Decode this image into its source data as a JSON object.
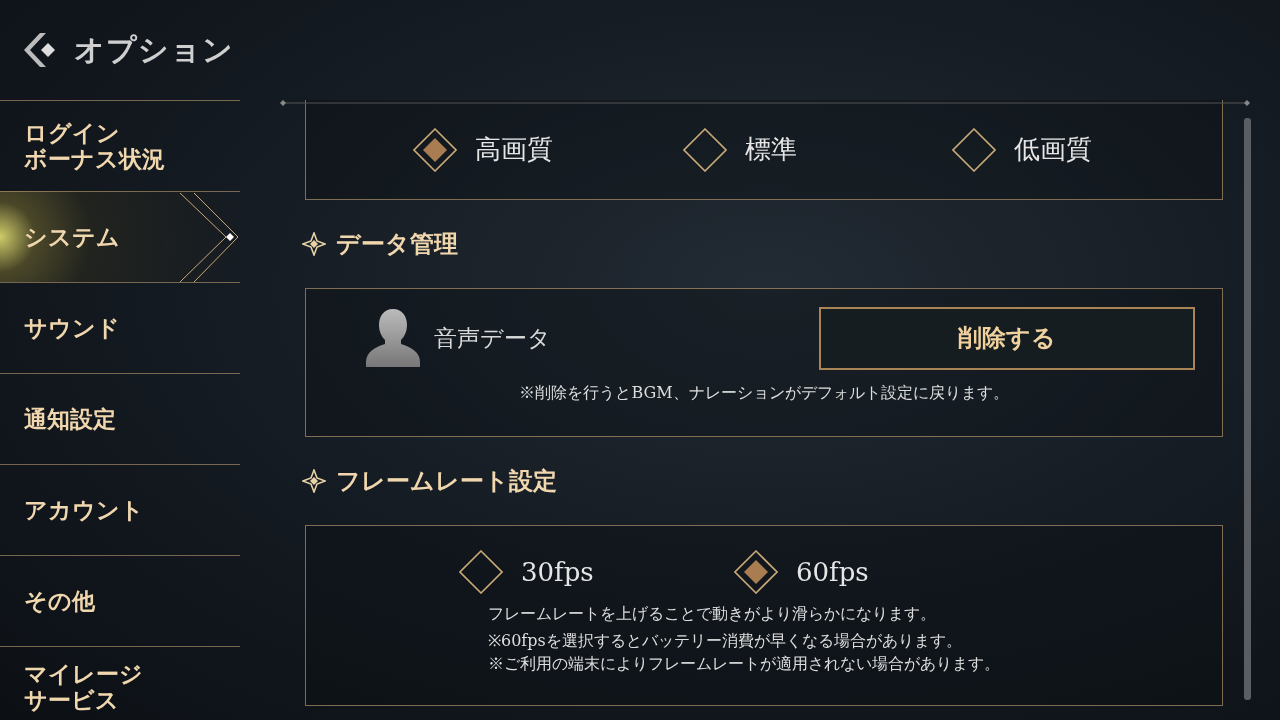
{
  "header": {
    "title": "オプション"
  },
  "sidebar": {
    "items": [
      {
        "lines": [
          "ログイン",
          "ボーナス状況"
        ],
        "selected": false
      },
      {
        "lines": [
          "システム"
        ],
        "selected": true
      },
      {
        "lines": [
          "サウンド"
        ],
        "selected": false
      },
      {
        "lines": [
          "通知設定"
        ],
        "selected": false
      },
      {
        "lines": [
          "アカウント"
        ],
        "selected": false
      },
      {
        "lines": [
          "その他"
        ],
        "selected": false
      },
      {
        "lines": [
          "マイレージ",
          "サービス"
        ],
        "selected": false
      }
    ]
  },
  "graphics_quality": {
    "options": [
      {
        "label": "高画質",
        "selected": true
      },
      {
        "label": "標準",
        "selected": false
      },
      {
        "label": "低画質",
        "selected": false
      }
    ]
  },
  "sections": [
    {
      "kind": "data",
      "title": "データ管理",
      "label": "音声データ",
      "button": "削除する",
      "notes": [
        "※削除を行うとBGM、ナレーションがデフォルト設定に戻ります。"
      ]
    },
    {
      "kind": "options",
      "title": "フレームレート設定",
      "options": [
        {
          "label": "30fps",
          "selected": false
        },
        {
          "label": "60fps",
          "selected": true
        }
      ],
      "notes": [
        "フレームレートを上げることで動きがより滑らかになります。",
        "※60fpsを選択するとバッテリー消費が早くなる場合があります。",
        "※ご利用の端末によりフレームレートが適用されない場合があります。"
      ]
    }
  ]
}
